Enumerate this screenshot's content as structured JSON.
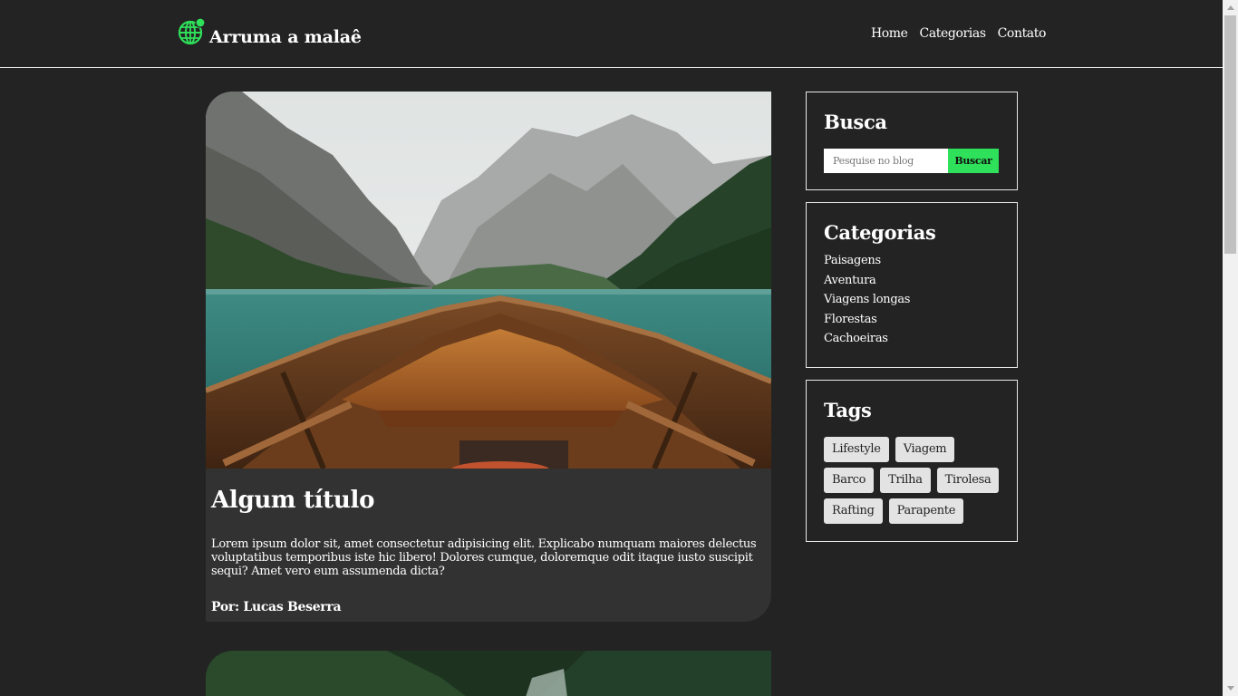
{
  "header": {
    "brand": "Arruma a malaê",
    "logo_icon": "globe-pin-icon",
    "nav": [
      {
        "label": "Home"
      },
      {
        "label": "Categorias"
      },
      {
        "label": "Contato"
      }
    ]
  },
  "post": {
    "image_alt": "Proa de barco de madeira em lago cercado por montanhas",
    "title": "Algum título",
    "text": "Lorem ipsum dolor sit, amet consectetur adipisicing elit. Explicabo numquam maiores delectus voluptatibus temporibus iste hic libero! Dolores cumque, doloremque odit itaque iusto suscipit sequi? Amet vero eum assumenda dicta?",
    "author": "Por: Lucas Beserra"
  },
  "sidebar": {
    "search": {
      "title": "Busca",
      "placeholder": "Pesquise no blog",
      "button": "Buscar"
    },
    "categories": {
      "title": "Categorias",
      "items": [
        "Paisagens",
        "Aventura",
        "Viagens longas",
        "Florestas",
        "Cachoeiras"
      ]
    },
    "tags": {
      "title": "Tags",
      "items": [
        "Lifestyle",
        "Viagem",
        "Barco",
        "Trilha",
        "Tirolesa",
        "Rafting",
        "Parapente"
      ]
    }
  },
  "colors": {
    "background": "#232323",
    "card": "#323232",
    "accent": "#2fe05a",
    "tag_bg": "#e3e3e3"
  }
}
